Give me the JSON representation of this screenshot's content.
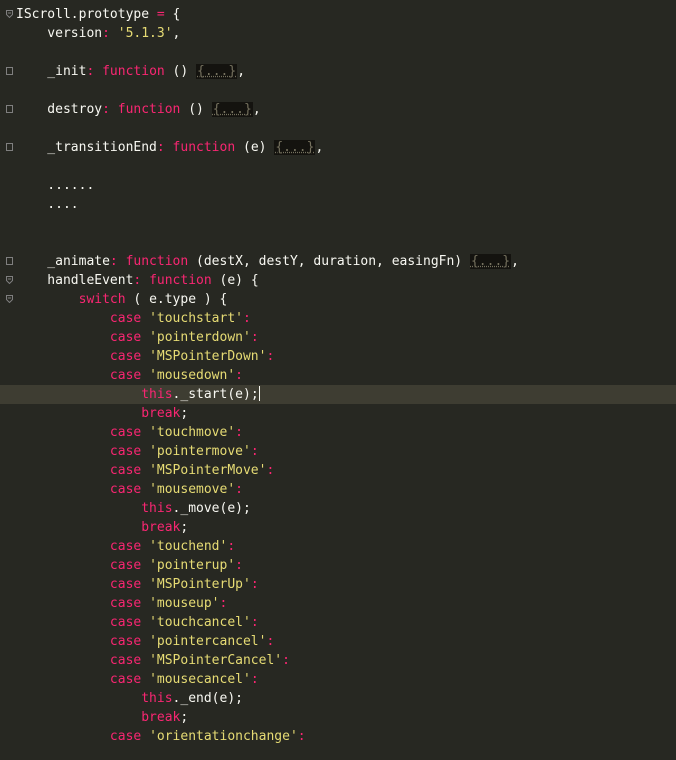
{
  "editor": {
    "theme_colors": {
      "background": "#272822",
      "text": "#f8f8f2",
      "keyword": "#f92672",
      "string": "#e6db74",
      "comment": "#75715e",
      "active_line": "#3e3d32"
    },
    "lines": [
      {
        "fold": "open",
        "tokens": [
          {
            "t": "plain",
            "v": "IScroll.prototype "
          },
          {
            "t": "kw",
            "v": "="
          },
          {
            "t": "plain",
            "v": " {"
          }
        ]
      },
      {
        "tokens": [
          {
            "t": "plain",
            "v": "    version"
          },
          {
            "t": "kw",
            "v": ":"
          },
          {
            "t": "plain",
            "v": " "
          },
          {
            "t": "str",
            "v": "'5.1.3'"
          },
          {
            "t": "plain",
            "v": ","
          }
        ]
      },
      {
        "tokens": []
      },
      {
        "fold": "closed",
        "tokens": [
          {
            "t": "plain",
            "v": "    _init"
          },
          {
            "t": "kw",
            "v": ":"
          },
          {
            "t": "plain",
            "v": " "
          },
          {
            "t": "kw",
            "v": "function"
          },
          {
            "t": "plain",
            "v": " () "
          },
          {
            "t": "placeholder",
            "v": "{...}"
          },
          {
            "t": "plain",
            "v": ","
          }
        ]
      },
      {
        "tokens": []
      },
      {
        "fold": "closed",
        "tokens": [
          {
            "t": "plain",
            "v": "    destroy"
          },
          {
            "t": "kw",
            "v": ":"
          },
          {
            "t": "plain",
            "v": " "
          },
          {
            "t": "kw",
            "v": "function"
          },
          {
            "t": "plain",
            "v": " () "
          },
          {
            "t": "placeholder",
            "v": "{...}"
          },
          {
            "t": "plain",
            "v": ","
          }
        ]
      },
      {
        "tokens": []
      },
      {
        "fold": "closed",
        "tokens": [
          {
            "t": "plain",
            "v": "    _transitionEnd"
          },
          {
            "t": "kw",
            "v": ":"
          },
          {
            "t": "plain",
            "v": " "
          },
          {
            "t": "kw",
            "v": "function"
          },
          {
            "t": "plain",
            "v": " (e) "
          },
          {
            "t": "placeholder",
            "v": "{...}"
          },
          {
            "t": "plain",
            "v": ","
          }
        ]
      },
      {
        "tokens": []
      },
      {
        "tokens": [
          {
            "t": "plain",
            "v": "    ......"
          }
        ]
      },
      {
        "tokens": [
          {
            "t": "plain",
            "v": "    ...."
          }
        ]
      },
      {
        "tokens": []
      },
      {
        "tokens": []
      },
      {
        "fold": "closed",
        "tokens": [
          {
            "t": "plain",
            "v": "    _animate"
          },
          {
            "t": "kw",
            "v": ":"
          },
          {
            "t": "plain",
            "v": " "
          },
          {
            "t": "kw",
            "v": "function"
          },
          {
            "t": "plain",
            "v": " (destX, destY, duration, easingFn) "
          },
          {
            "t": "placeholder",
            "v": "{...}"
          },
          {
            "t": "plain",
            "v": ","
          }
        ]
      },
      {
        "fold": "open",
        "tokens": [
          {
            "t": "plain",
            "v": "    handleEvent"
          },
          {
            "t": "kw",
            "v": ":"
          },
          {
            "t": "plain",
            "v": " "
          },
          {
            "t": "kw",
            "v": "function"
          },
          {
            "t": "plain",
            "v": " (e) {"
          }
        ]
      },
      {
        "fold": "open",
        "tokens": [
          {
            "t": "plain",
            "v": "        "
          },
          {
            "t": "kw",
            "v": "switch"
          },
          {
            "t": "plain",
            "v": " ( e.type ) {"
          }
        ]
      },
      {
        "tokens": [
          {
            "t": "plain",
            "v": "            "
          },
          {
            "t": "kw",
            "v": "case"
          },
          {
            "t": "plain",
            "v": " "
          },
          {
            "t": "str",
            "v": "'touchstart'"
          },
          {
            "t": "kw",
            "v": ":"
          }
        ]
      },
      {
        "tokens": [
          {
            "t": "plain",
            "v": "            "
          },
          {
            "t": "kw",
            "v": "case"
          },
          {
            "t": "plain",
            "v": " "
          },
          {
            "t": "str",
            "v": "'pointerdown'"
          },
          {
            "t": "kw",
            "v": ":"
          }
        ]
      },
      {
        "tokens": [
          {
            "t": "plain",
            "v": "            "
          },
          {
            "t": "kw",
            "v": "case"
          },
          {
            "t": "plain",
            "v": " "
          },
          {
            "t": "str",
            "v": "'MSPointerDown'"
          },
          {
            "t": "kw",
            "v": ":"
          }
        ]
      },
      {
        "tokens": [
          {
            "t": "plain",
            "v": "            "
          },
          {
            "t": "kw",
            "v": "case"
          },
          {
            "t": "plain",
            "v": " "
          },
          {
            "t": "str",
            "v": "'mousedown'"
          },
          {
            "t": "kw",
            "v": ":"
          }
        ]
      },
      {
        "active": true,
        "tokens": [
          {
            "t": "plain",
            "v": "                "
          },
          {
            "t": "kw",
            "v": "this"
          },
          {
            "t": "plain",
            "v": "._start(e);"
          },
          {
            "t": "cursor",
            "v": ""
          }
        ]
      },
      {
        "tokens": [
          {
            "t": "plain",
            "v": "                "
          },
          {
            "t": "kw",
            "v": "break"
          },
          {
            "t": "plain",
            "v": ";"
          }
        ]
      },
      {
        "tokens": [
          {
            "t": "plain",
            "v": "            "
          },
          {
            "t": "kw",
            "v": "case"
          },
          {
            "t": "plain",
            "v": " "
          },
          {
            "t": "str",
            "v": "'touchmove'"
          },
          {
            "t": "kw",
            "v": ":"
          }
        ]
      },
      {
        "tokens": [
          {
            "t": "plain",
            "v": "            "
          },
          {
            "t": "kw",
            "v": "case"
          },
          {
            "t": "plain",
            "v": " "
          },
          {
            "t": "str",
            "v": "'pointermove'"
          },
          {
            "t": "kw",
            "v": ":"
          }
        ]
      },
      {
        "tokens": [
          {
            "t": "plain",
            "v": "            "
          },
          {
            "t": "kw",
            "v": "case"
          },
          {
            "t": "plain",
            "v": " "
          },
          {
            "t": "str",
            "v": "'MSPointerMove'"
          },
          {
            "t": "kw",
            "v": ":"
          }
        ]
      },
      {
        "tokens": [
          {
            "t": "plain",
            "v": "            "
          },
          {
            "t": "kw",
            "v": "case"
          },
          {
            "t": "plain",
            "v": " "
          },
          {
            "t": "str",
            "v": "'mousemove'"
          },
          {
            "t": "kw",
            "v": ":"
          }
        ]
      },
      {
        "tokens": [
          {
            "t": "plain",
            "v": "                "
          },
          {
            "t": "kw",
            "v": "this"
          },
          {
            "t": "plain",
            "v": "._move(e);"
          }
        ]
      },
      {
        "tokens": [
          {
            "t": "plain",
            "v": "                "
          },
          {
            "t": "kw",
            "v": "break"
          },
          {
            "t": "plain",
            "v": ";"
          }
        ]
      },
      {
        "tokens": [
          {
            "t": "plain",
            "v": "            "
          },
          {
            "t": "kw",
            "v": "case"
          },
          {
            "t": "plain",
            "v": " "
          },
          {
            "t": "str",
            "v": "'touchend'"
          },
          {
            "t": "kw",
            "v": ":"
          }
        ]
      },
      {
        "tokens": [
          {
            "t": "plain",
            "v": "            "
          },
          {
            "t": "kw",
            "v": "case"
          },
          {
            "t": "plain",
            "v": " "
          },
          {
            "t": "str",
            "v": "'pointerup'"
          },
          {
            "t": "kw",
            "v": ":"
          }
        ]
      },
      {
        "tokens": [
          {
            "t": "plain",
            "v": "            "
          },
          {
            "t": "kw",
            "v": "case"
          },
          {
            "t": "plain",
            "v": " "
          },
          {
            "t": "str",
            "v": "'MSPointerUp'"
          },
          {
            "t": "kw",
            "v": ":"
          }
        ]
      },
      {
        "tokens": [
          {
            "t": "plain",
            "v": "            "
          },
          {
            "t": "kw",
            "v": "case"
          },
          {
            "t": "plain",
            "v": " "
          },
          {
            "t": "str",
            "v": "'mouseup'"
          },
          {
            "t": "kw",
            "v": ":"
          }
        ]
      },
      {
        "tokens": [
          {
            "t": "plain",
            "v": "            "
          },
          {
            "t": "kw",
            "v": "case"
          },
          {
            "t": "plain",
            "v": " "
          },
          {
            "t": "str",
            "v": "'touchcancel'"
          },
          {
            "t": "kw",
            "v": ":"
          }
        ]
      },
      {
        "tokens": [
          {
            "t": "plain",
            "v": "            "
          },
          {
            "t": "kw",
            "v": "case"
          },
          {
            "t": "plain",
            "v": " "
          },
          {
            "t": "str",
            "v": "'pointercancel'"
          },
          {
            "t": "kw",
            "v": ":"
          }
        ]
      },
      {
        "tokens": [
          {
            "t": "plain",
            "v": "            "
          },
          {
            "t": "kw",
            "v": "case"
          },
          {
            "t": "plain",
            "v": " "
          },
          {
            "t": "str",
            "v": "'MSPointerCancel'"
          },
          {
            "t": "kw",
            "v": ":"
          }
        ]
      },
      {
        "tokens": [
          {
            "t": "plain",
            "v": "            "
          },
          {
            "t": "kw",
            "v": "case"
          },
          {
            "t": "plain",
            "v": " "
          },
          {
            "t": "str",
            "v": "'mousecancel'"
          },
          {
            "t": "kw",
            "v": ":"
          }
        ]
      },
      {
        "tokens": [
          {
            "t": "plain",
            "v": "                "
          },
          {
            "t": "kw",
            "v": "this"
          },
          {
            "t": "plain",
            "v": "._end(e);"
          }
        ]
      },
      {
        "tokens": [
          {
            "t": "plain",
            "v": "                "
          },
          {
            "t": "kw",
            "v": "break"
          },
          {
            "t": "plain",
            "v": ";"
          }
        ]
      },
      {
        "tokens": [
          {
            "t": "plain",
            "v": "            "
          },
          {
            "t": "kw",
            "v": "case"
          },
          {
            "t": "plain",
            "v": " "
          },
          {
            "t": "str",
            "v": "'orientationchange'"
          },
          {
            "t": "kw",
            "v": ":"
          }
        ]
      }
    ]
  }
}
